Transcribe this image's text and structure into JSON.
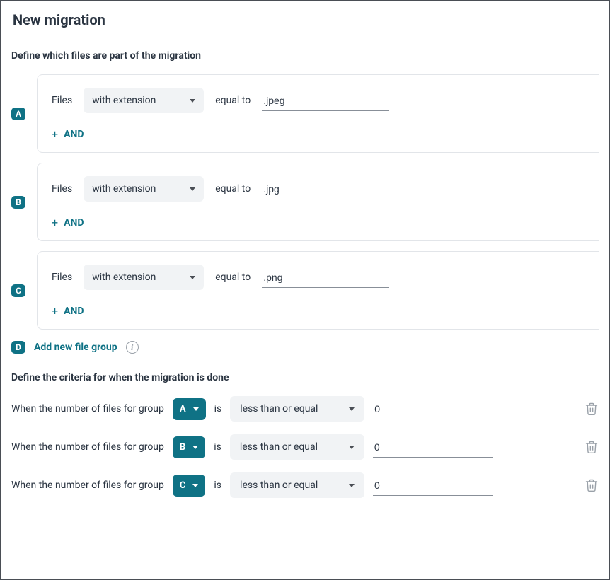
{
  "header": {
    "title": "New migration"
  },
  "section1_label": "Define which files are part of the migration",
  "section2_label": "Define the criteria for when the migration is done",
  "groups": [
    {
      "letter": "A",
      "files_label": "Files",
      "select_value": "with extension",
      "equal_label": "equal to",
      "input_value": ".jpeg",
      "and_label": "AND"
    },
    {
      "letter": "B",
      "files_label": "Files",
      "select_value": "with extension",
      "equal_label": "equal to",
      "input_value": ".jpg",
      "and_label": "AND"
    },
    {
      "letter": "C",
      "files_label": "Files",
      "select_value": "with extension",
      "equal_label": "equal to",
      "input_value": ".png",
      "and_label": "AND"
    }
  ],
  "add_group": {
    "letter": "D",
    "label": "Add new file group"
  },
  "criteria": [
    {
      "prefix": "When the number of files for group",
      "group": "A",
      "is_label": "is",
      "op": "less than or equal",
      "value": "0"
    },
    {
      "prefix": "When the number of files for group",
      "group": "B",
      "is_label": "is",
      "op": "less than or equal",
      "value": "0"
    },
    {
      "prefix": "When the number of files for group",
      "group": "C",
      "is_label": "is",
      "op": "less than or equal",
      "value": "0"
    }
  ]
}
